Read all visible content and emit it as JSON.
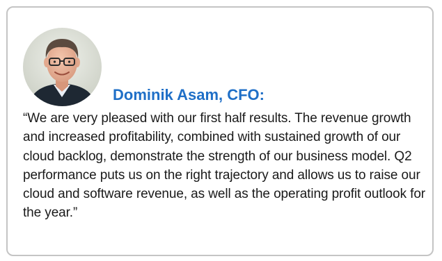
{
  "speaker": {
    "name": "Dominik Asam, CFO:"
  },
  "quote": {
    "text": "“We are very pleased with our first half results. The revenue growth and increased profitability, combined with sustained growth of our cloud backlog, demonstrate the strength of our business model. Q2 performance puts us on the right trajectory and allows us to raise our cloud and software revenue, as well as the operating profit outlook for the year.”"
  },
  "colors": {
    "accent": "#1f6fc7",
    "text": "#1a1a1a",
    "border": "#c4c4c4"
  }
}
